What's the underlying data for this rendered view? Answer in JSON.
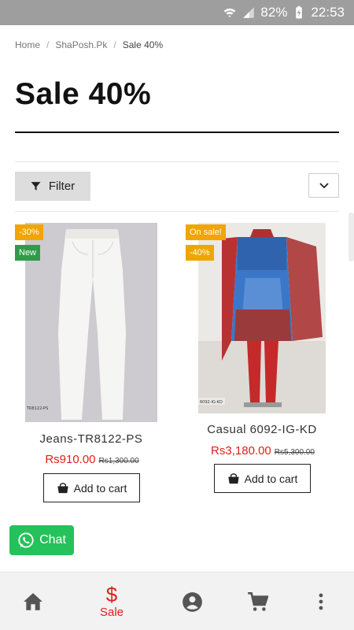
{
  "status_bar": {
    "battery": "82%",
    "time": "22:53"
  },
  "breadcrumb": [
    {
      "label": "Home"
    },
    {
      "label": "ShaPosh.Pk"
    },
    {
      "label": "Sale 40%"
    }
  ],
  "page_title": "Sale 40%",
  "toolbar": {
    "filter_label": "Filter"
  },
  "products": [
    {
      "badges": [
        "-30%",
        "New"
      ],
      "name": "Jeans-TR8122-PS",
      "price": "Rs910.00",
      "old_price": "Rs1,300.00",
      "cart_label": "Add to cart",
      "tag": "TR8122-PS"
    },
    {
      "badges": [
        "On sale!",
        "-40%"
      ],
      "name": "Casual 6092-IG-KD",
      "price": "Rs3,180.00",
      "old_price": "Rs5,300.00",
      "cart_label": "Add to cart",
      "tag": "6092-IG-KD"
    }
  ],
  "chat": {
    "label": "Chat"
  },
  "bottom_nav": {
    "sale_symbol": "$",
    "sale_label": "Sale"
  },
  "colors": {
    "accent_red": "#e0201a",
    "sale_badge": "#f0a500",
    "new_badge": "#2e9d4a",
    "chat_green": "#25c25b"
  }
}
